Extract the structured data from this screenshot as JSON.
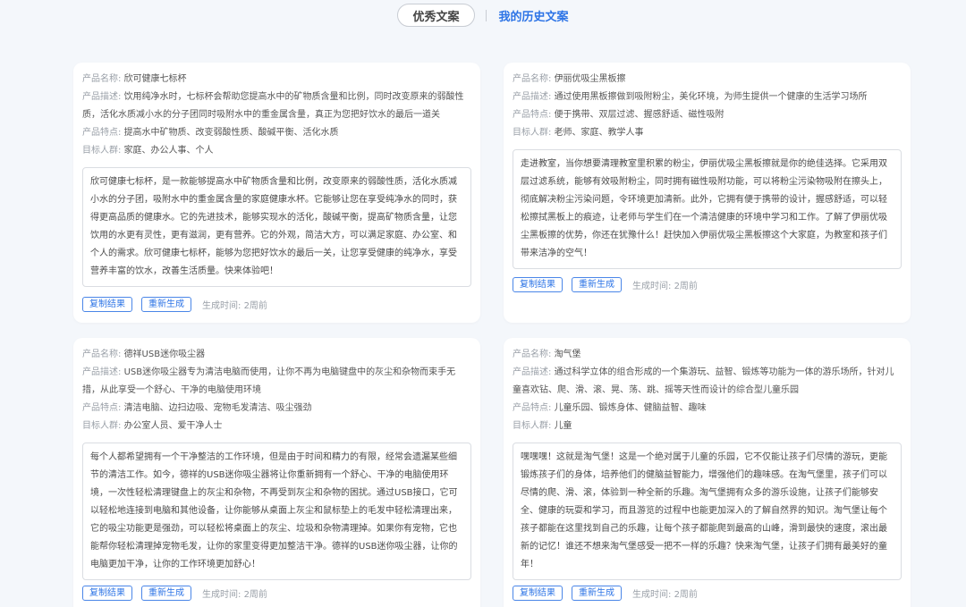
{
  "tabs": {
    "excellent": "优秀文案",
    "history": "我的历史文案"
  },
  "labels": {
    "name": "产品名称: ",
    "desc": "产品描述: ",
    "features": "产品特点: ",
    "audience": "目标人群: ",
    "copy": "复制结果",
    "regen": "重新生成",
    "time": "生成时间: "
  },
  "cards": [
    {
      "name": "欣可健康七标杯",
      "desc": "饮用纯净水时，七标杯会帮助您提高水中的矿物质含量和比例，同时改变原来的弱酸性质，活化水质减小水的分子团同时吸附水中的重金属含量，真正为您把好饮水的最后一道关",
      "features": "提高水中矿物质、改变弱酸性质、酸碱平衡、活化水质",
      "audience": "家庭、办公人事、个人",
      "result": "欣可健康七标杯，是一款能够提高水中矿物质含量和比例，改变原来的弱酸性质，活化水质减小水的分子团，吸附水中的重金属含量的家庭健康水杯。它能够让您在享受纯净水的同时，获得更高品质的健康水。它的先进技术，能够实现水的活化，酸碱平衡，提高矿物质含量，让您饮用的水更有灵性，更有滋润，更有营养。它的外观，简洁大方，可以满足家庭、办公室、和个人的需求。欣可健康七标杯，能够为您把好饮水的最后一关，让您享受健康的纯净水，享受营养丰富的饮水，改善生活质量。快来体验吧！",
      "time": "2周前"
    },
    {
      "name": "伊丽优吸尘黑板擦",
      "desc": "通过使用黑板擦做到吸附粉尘，美化环境，为师生提供一个健康的生活学习场所",
      "features": "便于携带、双层过滤、握感舒适、磁性吸附",
      "audience": "老师、家庭、教学人事",
      "result": "走进教室，当你想要清理教室里积累的粉尘，伊丽优吸尘黑板擦就是你的绝佳选择。它采用双层过滤系统，能够有效吸附粉尘，同时拥有磁性吸附功能，可以将粉尘污染物吸附在擦头上，彻底解决粉尘污染问题，令环境更加清新。此外，它拥有便于携带的设计，握感舒适，可以轻松擦拭黑板上的痕迹，让老师与学生们在一个清洁健康的环境中学习和工作。了解了伊丽优吸尘黑板擦的优势，你还在犹豫什么！赶快加入伊丽优吸尘黑板擦这个大家庭，为教室和孩子们带来洁净的空气！",
      "time": "2周前"
    },
    {
      "name": "德祥USB迷你吸尘器",
      "desc": "USB迷你吸尘器专为清洁电脑而使用，让你不再为电脑键盘中的灰尘和杂物而束手无措，从此享受一个舒心、干净的电脑使用环境",
      "features": "清洁电脑、边扫边吸、宠物毛发清洁、吸尘强劲",
      "audience": "办公室人员、爱干净人士",
      "result": "每个人都希望拥有一个干净整洁的工作环境，但是由于时间和精力的有限，经常会遗漏某些细节的清洁工作。如今，德祥的USB迷你吸尘器将让你重新拥有一个舒心、干净的电脑使用环境，一次性轻松清理键盘上的灰尘和杂物，不再受到灰尘和杂物的困扰。通过USB接口，它可以轻松地连接到电脑和其他设备，让你能够从桌面上灰尘和鼠标垫上的毛发中轻松清理出来，它的吸尘功能更是强劲，可以轻松将桌面上的灰尘、垃圾和杂物清理掉。如果你有宠物，它也能帮你轻松清理掉宠物毛发，让你的家里变得更加整洁干净。德祥的USB迷你吸尘器，让你的电脑更加干净，让你的工作环境更加舒心！",
      "time": "2周前"
    },
    {
      "name": "淘气堡",
      "desc": "通过科学立体的组合形成的一个集游玩、益智、锻炼等功能为一体的游乐场所，针对儿童喜欢钻、爬、滑、滚、晃、荡、跳、摇等天性而设计的综合型儿童乐园",
      "features": "儿童乐园、锻炼身体、健脑益智、趣味",
      "audience": "儿童",
      "result": "嘿嘿嘿！这就是淘气堡！这是一个绝对属于儿童的乐园，它不仅能让孩子们尽情的游玩，更能锻炼孩子们的身体，培养他们的健脑益智能力，增强他们的趣味感。在淘气堡里，孩子们可以尽情的爬、滑、滚，体验到一种全新的乐趣。淘气堡拥有众多的游乐设施，让孩子们能够安全、健康的玩耍和学习，而且游览的过程中也能更加深入的了解自然界的知识。淘气堡让每个孩子都能在这里找到自己的乐趣，让每个孩子都能爬到最高的山峰，滑到最快的速度，滚出最新的记忆！谁还不想来淘气堡感受一把不一样的乐趣？快来淘气堡，让孩子们拥有最美好的童年！",
      "time": "2周前"
    }
  ]
}
